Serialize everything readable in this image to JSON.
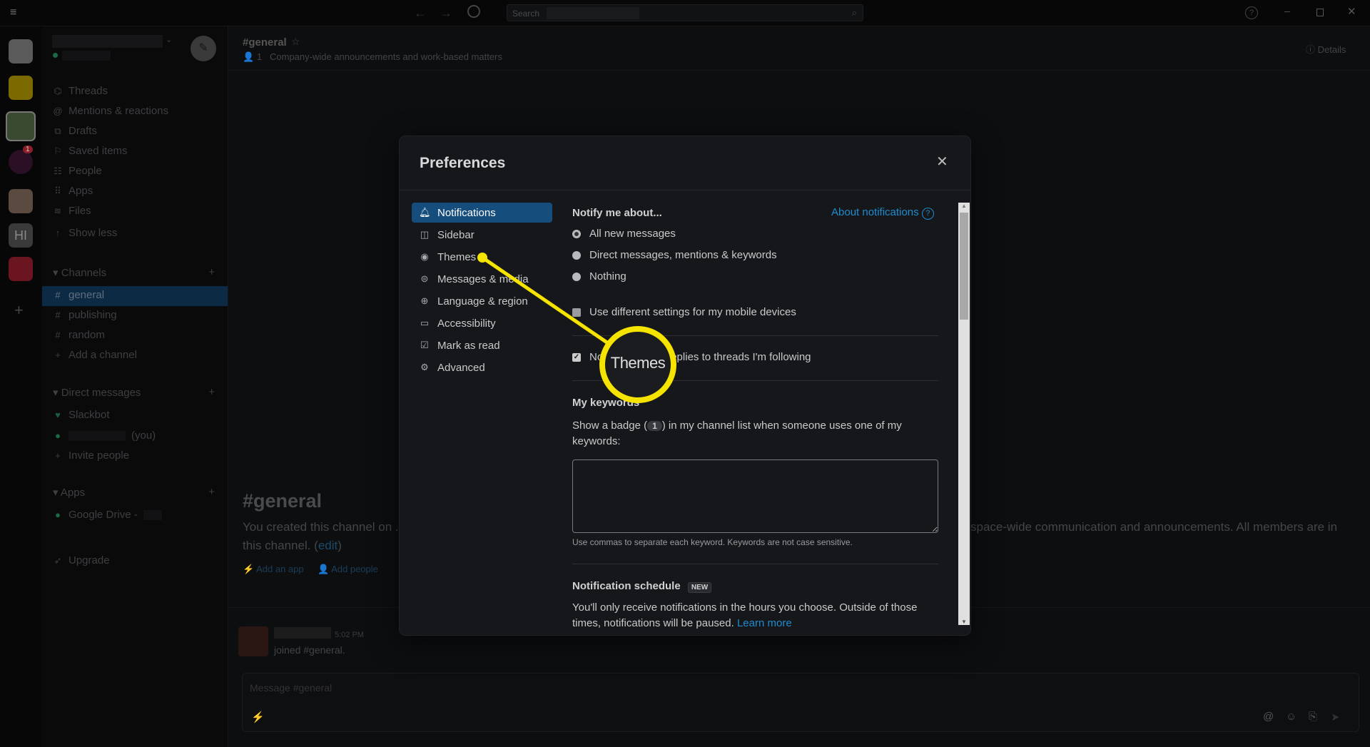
{
  "titlebar": {
    "search_placeholder": "Search"
  },
  "workspace_rail": {
    "badge": "1",
    "hi_label": "HI"
  },
  "sidebar": {
    "nav": [
      {
        "label": "Threads",
        "icon": "threads-icon"
      },
      {
        "label": "Mentions & reactions",
        "icon": "at-icon"
      },
      {
        "label": "Drafts",
        "icon": "drafts-icon"
      },
      {
        "label": "Saved items",
        "icon": "bookmark-icon"
      },
      {
        "label": "People",
        "icon": "people-icon"
      },
      {
        "label": "Apps",
        "icon": "apps-icon"
      },
      {
        "label": "Files",
        "icon": "files-icon"
      },
      {
        "label": "Show less",
        "icon": "arrow-up-icon"
      }
    ],
    "channels_title": "Channels",
    "channels": [
      "general",
      "publishing",
      "random"
    ],
    "add_channel": "Add a channel",
    "dm_title": "Direct messages",
    "dms": [
      "Slackbot",
      "(you)"
    ],
    "invite": "Invite people",
    "apps_title": "Apps",
    "apps": [
      "Google Drive -"
    ],
    "upgrade": "Upgrade"
  },
  "channel": {
    "name": "#general",
    "members": "1",
    "topic": "Company-wide announcements and work-based matters",
    "details": "Details",
    "intro_title": "#general",
    "intro_text_left": "You created this channel on .",
    "intro_text_right": "space-wide communication and announcements. All members are in",
    "intro_text_line2": "this channel. (",
    "edit": "edit",
    "add_app": "Add an app",
    "add_people": "Add people",
    "msg_time": "5:02 PM",
    "msg_text": "joined #general.",
    "composer_placeholder": "Message #general"
  },
  "modal": {
    "title": "Preferences",
    "nav": [
      {
        "label": "Notifications",
        "icon": "bell-icon"
      },
      {
        "label": "Sidebar",
        "icon": "sidebar-icon"
      },
      {
        "label": "Themes",
        "icon": "eye-icon"
      },
      {
        "label": "Messages & media",
        "icon": "message-icon"
      },
      {
        "label": "Language & region",
        "icon": "globe-icon"
      },
      {
        "label": "Accessibility",
        "icon": "laptop-icon"
      },
      {
        "label": "Mark as read",
        "icon": "check-icon"
      },
      {
        "label": "Advanced",
        "icon": "gear-icon"
      }
    ],
    "active_nav": "Notifications",
    "notify_title": "Notify me about...",
    "about_link": "About notifications",
    "options": [
      "All new messages",
      "Direct messages, mentions & keywords",
      "Nothing"
    ],
    "selected_option": "All new messages",
    "mobile_checkbox": "Use different settings for my mobile devices",
    "mobile_checked": false,
    "threads_checkbox": "Notify me about replies to threads I'm following",
    "threads_checked": true,
    "keywords_title": "My keywords",
    "keywords_desc_pre": "Show a badge (",
    "keywords_badge": "1",
    "keywords_desc_post": ") in my channel list when someone uses one of my keywords:",
    "keywords_value": "",
    "keywords_hint": "Use commas to separate each keyword. Keywords are not case sensitive.",
    "schedule_title": "Notification schedule",
    "schedule_badge": "NEW",
    "schedule_text": "You'll only receive notifications in the hours you choose. Outside of those times, notifications will be paused.",
    "learn_more": "Learn more"
  },
  "annotation": {
    "callout_label": "Themes",
    "color": "#f5e400"
  }
}
